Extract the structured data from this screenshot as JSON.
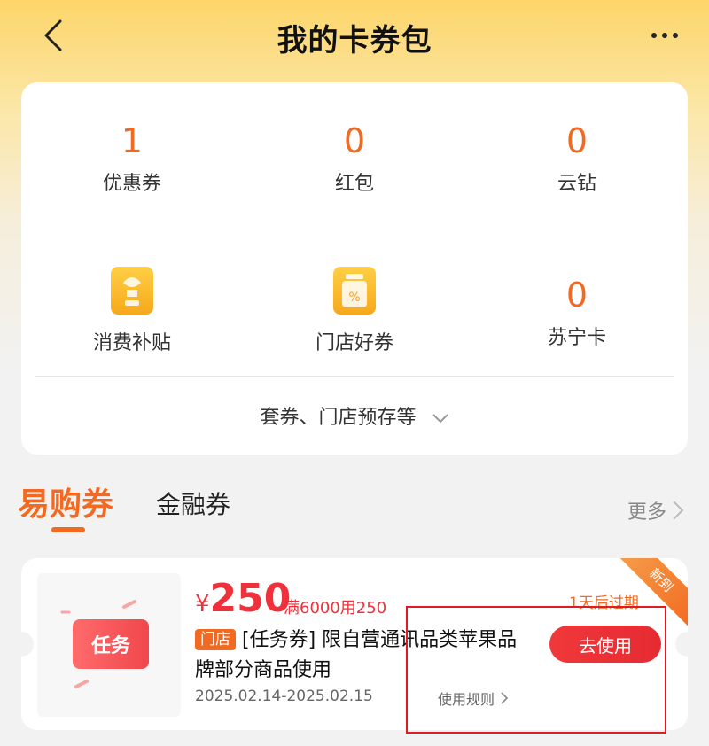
{
  "header": {
    "title": "我的卡券包",
    "back_icon": "back-arrow-icon",
    "more_icon": "more-dots-icon"
  },
  "stats": [
    {
      "value": "1",
      "label": "优惠券"
    },
    {
      "value": "0",
      "label": "红包"
    },
    {
      "value": "0",
      "label": "云钻"
    }
  ],
  "stats2": [
    {
      "icon": "subsidy-icon",
      "label": "消费补贴"
    },
    {
      "icon": "store-coupon-icon",
      "label": "门店好券"
    },
    {
      "value": "0",
      "label": "苏宁卡"
    }
  ],
  "expand_label": "套券、门店预存等",
  "tabs": {
    "active": "易购券",
    "second": "金融券",
    "more": "更多"
  },
  "coupon": {
    "currency": "¥",
    "amount": "250",
    "threshold": "满6000用250",
    "expire": "1天后过期",
    "store_tag": "门店",
    "description": "[任务券] 限自营通讯品类苹果品牌部分商品使用",
    "date_range": "2025.02.14-2025.02.15",
    "rules": "使用规则",
    "use_button": "去使用",
    "badge": "新到",
    "image_label": "任务"
  },
  "colors": {
    "accent": "#f26a21",
    "red": "#e62a32",
    "header_bg": "#fdd56a"
  }
}
